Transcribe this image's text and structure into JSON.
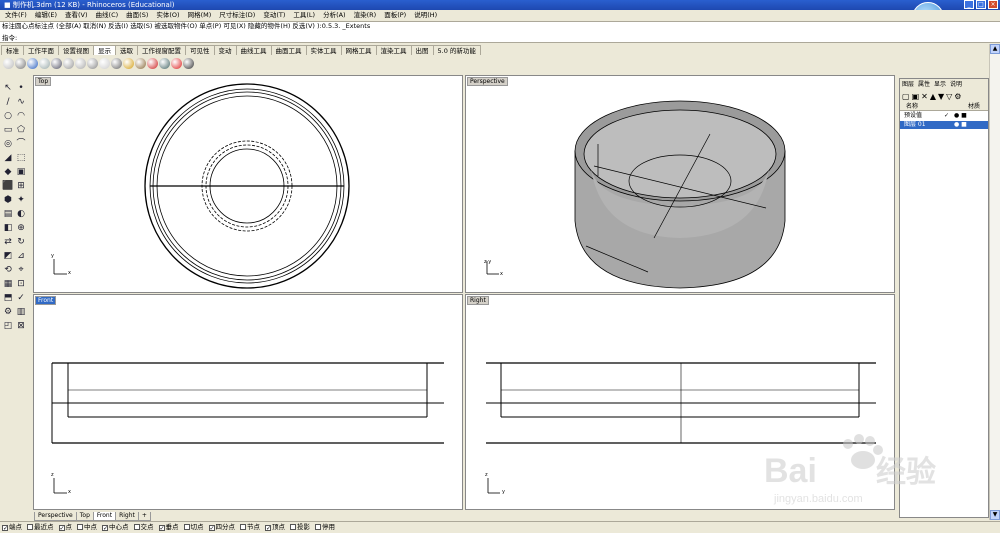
{
  "window": {
    "title": "■ 制作机.3dm (12 KB) - Rhinoceros (Educational)",
    "buttons": [
      "_",
      "□",
      "×"
    ]
  },
  "menubar": {
    "items": [
      "文件(F)",
      "编辑(E)",
      "查看(V)",
      "曲线(C)",
      "曲面(S)",
      "实体(O)",
      "网格(M)",
      "尺寸标注(D)",
      "变动(T)",
      "工具(L)",
      "分析(A)",
      "渲染(R)",
      "面板(P)",
      "说明(H)"
    ]
  },
  "command_history": "标注圆心点标注点 (全部(A) 取消(N) 反选(I) 选取(S) 被选取物件(O) 单点(P) 可见(X) 隐藏的物件(H) 反选(V) ):0.5.3. _Extents",
  "command_prompt": {
    "label": "指令:",
    "value": ""
  },
  "toolbar_tabs": {
    "items": [
      "标准",
      "工作平面",
      "设置视图",
      "显示",
      "选取",
      "工作视窗配置",
      "可见性",
      "变动",
      "曲线工具",
      "曲面工具",
      "实体工具",
      "网格工具",
      "渲染工具",
      "出图",
      "5.0 的新功能"
    ],
    "active_index": 3
  },
  "display_icons": [
    "wireframe-sphere-icon",
    "shaded-sphere-icon",
    "rendered-sphere-icon",
    "ghosted-sphere-icon",
    "xray-sphere-icon",
    "flat-sphere-icon",
    "technical-icon",
    "artistic-icon",
    "pen-icon",
    "shade-icon",
    "color-sphere-icon",
    "material-icon",
    "light-icon",
    "display-mode-icon",
    "no-render-icon",
    "monitor-icon"
  ],
  "viewports": [
    {
      "name": "Top",
      "active": false,
      "axes": {
        "v": "y",
        "h": "x"
      }
    },
    {
      "name": "Perspective",
      "active": false,
      "axes": {
        "v": "z y",
        "h": "x"
      }
    },
    {
      "name": "Front",
      "active": true,
      "axes": {
        "v": "z",
        "h": "x"
      }
    },
    {
      "name": "Right",
      "active": false,
      "axes": {
        "v": "z",
        "h": "y"
      }
    }
  ],
  "viewport_tabs": {
    "items": [
      "Perspective",
      "Top",
      "Front",
      "Right",
      "+"
    ],
    "active_index": 2
  },
  "layers_panel": {
    "tabs": [
      "图层",
      "属性",
      "显示",
      "说明"
    ],
    "header": {
      "name": "名称",
      "material": "材质"
    },
    "layers": [
      {
        "name": "预设值",
        "check": "✓",
        "selected": false
      },
      {
        "name": "图层 01",
        "check": "",
        "selected": true
      }
    ]
  },
  "osnaps": [
    {
      "label": "端点",
      "checked": true
    },
    {
      "label": "最近点",
      "checked": false
    },
    {
      "label": "点",
      "checked": true
    },
    {
      "label": "中点",
      "checked": false
    },
    {
      "label": "中心点",
      "checked": true
    },
    {
      "label": "交点",
      "checked": false
    },
    {
      "label": "垂点",
      "checked": true
    },
    {
      "label": "切点",
      "checked": false
    },
    {
      "label": "四分点",
      "checked": true
    },
    {
      "label": "节点",
      "checked": false
    },
    {
      "label": "顶点",
      "checked": true
    },
    {
      "label": "投影",
      "checked": false
    },
    {
      "label": "停用",
      "checked": false
    }
  ],
  "colors": {
    "titlebar": "#1e48b0",
    "active_tab": "#316ac5",
    "background": "#ece9d8"
  }
}
